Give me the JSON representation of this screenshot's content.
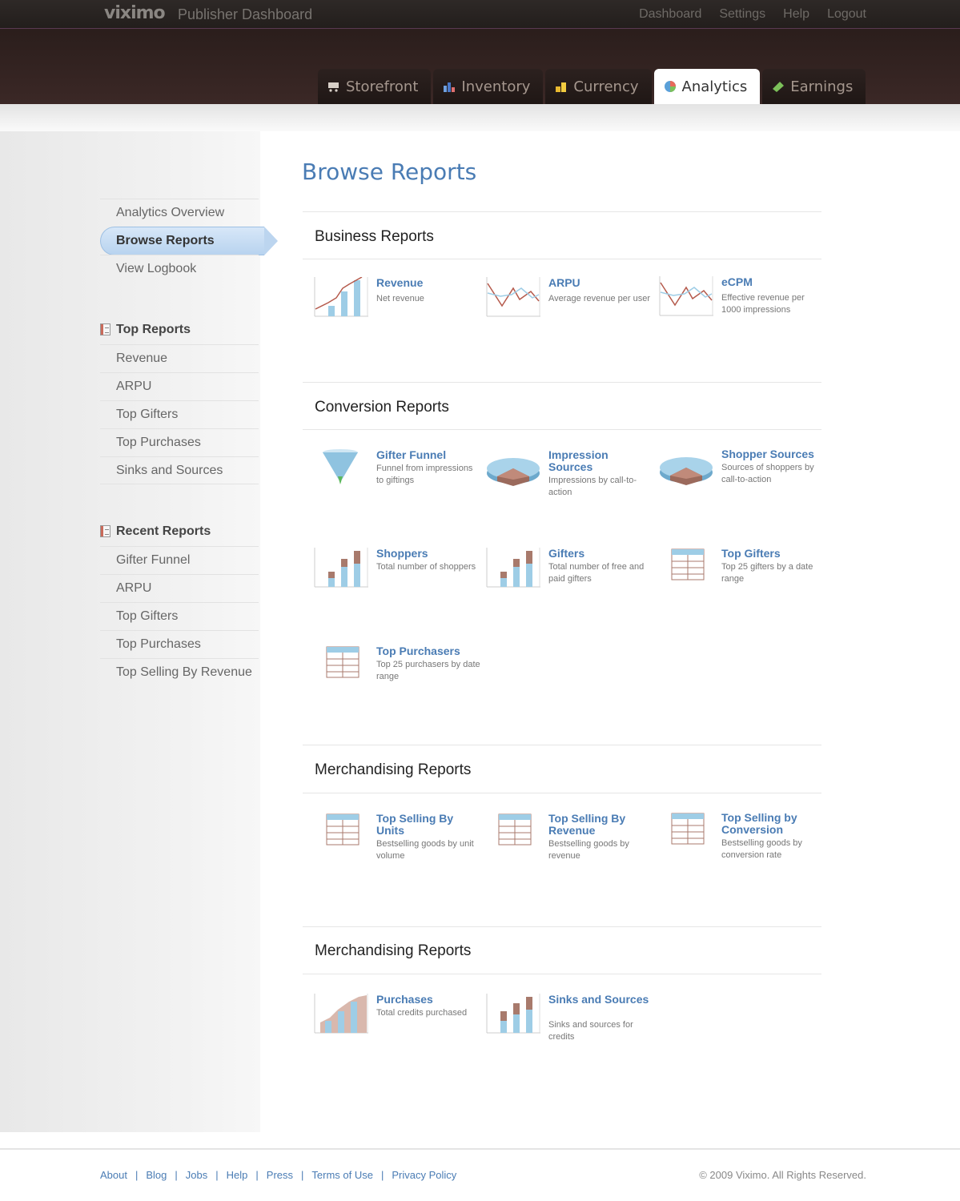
{
  "header": {
    "logo": "viximo",
    "app_title": "Publisher Dashboard",
    "top_links": [
      "Dashboard",
      "Settings",
      "Help",
      "Logout"
    ],
    "tabs": [
      "Storefront",
      "Inventory",
      "Currency",
      "Analytics",
      "Earnings"
    ],
    "active_tab": "Analytics"
  },
  "sidebar": {
    "nav": [
      "Analytics Overview",
      "Browse Reports",
      "View Logbook"
    ],
    "active": "Browse Reports",
    "top_reports_title": "Top Reports",
    "top_reports": [
      "Revenue",
      "ARPU",
      "Top Gifters",
      "Top Purchases",
      "Sinks and Sources"
    ],
    "recent_reports_title": "Recent Reports",
    "recent_reports": [
      "Gifter Funnel",
      "ARPU",
      "Top Gifters",
      "Top Purchases",
      "Top Selling By Revenue"
    ]
  },
  "main": {
    "title": "Browse Reports",
    "sections": [
      {
        "title": "Business Reports",
        "reports": [
          {
            "title": "Revenue",
            "desc": "Net revenue",
            "icon": "line-bar-chart-icon"
          },
          {
            "title": "ARPU",
            "desc": "Average revenue per user",
            "icon": "line-chart-icon"
          },
          {
            "title": "eCPM",
            "desc": "Effective revenue per 1000 impressions",
            "icon": "line-chart-icon"
          }
        ]
      },
      {
        "title": "Conversion Reports",
        "reports": [
          {
            "title": "Gifter Funnel",
            "desc": "Funnel from impressions to giftings",
            "icon": "funnel-icon"
          },
          {
            "title": "Impression Sources",
            "desc": "Impressions by call-to-action",
            "icon": "pie-chart-icon"
          },
          {
            "title": "Shopper Sources",
            "desc": "Sources of shoppers by call-to-action",
            "icon": "pie-chart-icon"
          },
          {
            "title": "Shoppers",
            "desc": "Total number of shoppers",
            "icon": "bar-chart-icon"
          },
          {
            "title": "Gifters",
            "desc": "Total number of free and paid gifters",
            "icon": "bar-chart-icon"
          },
          {
            "title": "Top Gifters",
            "desc": "Top 25 gifters by a date range",
            "icon": "table-icon"
          },
          {
            "title": "Top Purchasers",
            "desc": "Top 25 purchasers by date range",
            "icon": "table-icon"
          }
        ]
      },
      {
        "title": "Merchandising Reports",
        "reports": [
          {
            "title": "Top Selling By Units",
            "desc": "Bestselling goods by unit volume",
            "icon": "table-icon"
          },
          {
            "title": "Top Selling By Revenue",
            "desc": "Bestselling goods by revenue",
            "icon": "table-icon"
          },
          {
            "title": "Top Selling by Conversion",
            "desc": "Bestselling goods by conversion rate",
            "icon": "table-icon"
          }
        ]
      },
      {
        "title": "Merchandising Reports",
        "reports": [
          {
            "title": "Purchases",
            "desc": "Total credits purchased",
            "icon": "area-chart-icon"
          },
          {
            "title": "Sinks and Sources",
            "desc": "Sinks and sources for credits",
            "icon": "bar-chart-icon"
          }
        ]
      }
    ]
  },
  "footer": {
    "links": [
      "About",
      "Blog",
      "Jobs",
      "Help",
      "Press",
      "Terms of Use",
      "Privacy Policy"
    ],
    "separator": "|",
    "copyright": "© 2009 Viximo. All Rights Reserved."
  },
  "colors": {
    "accent": "#4a7cb4",
    "header": "#2b1e1c",
    "bar_blue": "#9ecde6",
    "bar_brown": "#a87a6c",
    "line_red": "#b55a4c"
  }
}
